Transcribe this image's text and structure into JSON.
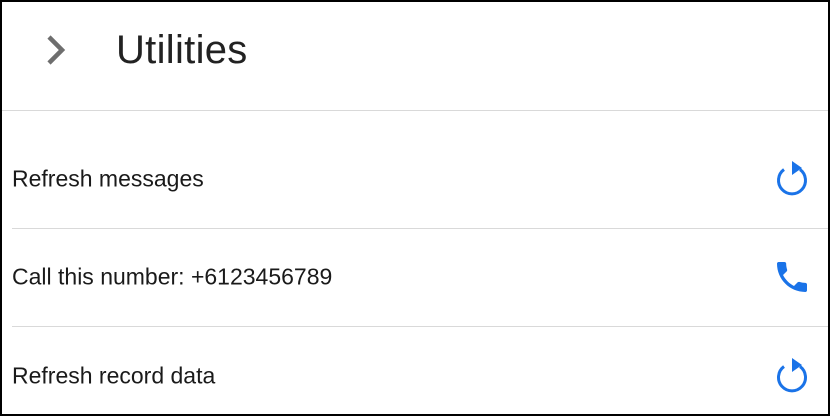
{
  "header": {
    "title": "Utilities",
    "back_icon": "chevron-right-icon"
  },
  "colors": {
    "accent": "#1a73e8",
    "title_text": "#222222",
    "chevron": "#6e6e6e",
    "divider": "#d9d9d9"
  },
  "utilities": [
    {
      "label": "Refresh messages",
      "icon": "refresh-icon"
    },
    {
      "label": "Call this number: +6123456789",
      "icon": "phone-icon"
    },
    {
      "label": "Refresh record data",
      "icon": "refresh-icon"
    }
  ]
}
